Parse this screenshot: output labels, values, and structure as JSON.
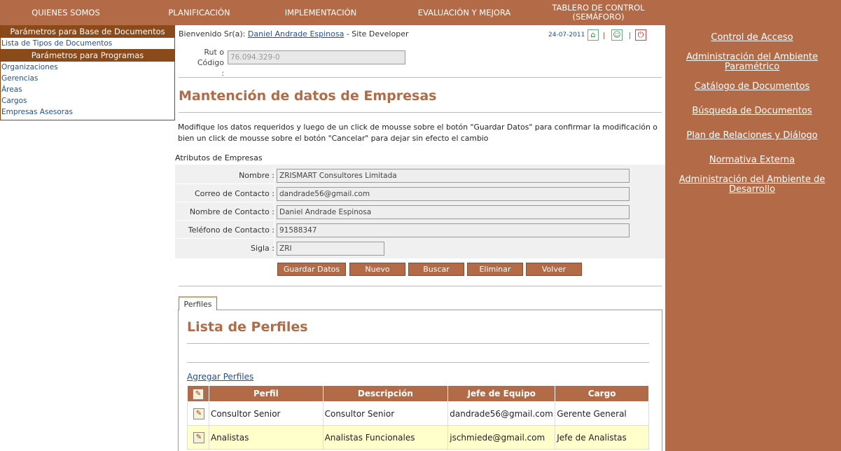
{
  "topnav": {
    "items": [
      "QUIENES SOMOS",
      "PLANIFICACIÓN",
      "IMPLEMENTACIÓN",
      "EVALUACIÓN Y MEJORA",
      "TABLERO DE CONTROL (SEMÁFORO)"
    ]
  },
  "sidebar": {
    "header1": "Parámetros para Base de Documentos",
    "item_tipos": "Lista de Tipos de Documentos",
    "header2": "Parámetros para Programas",
    "items": [
      "Organizaciones",
      "Gerencias",
      "Áreas",
      "Cargos",
      "Empresas Asesoras"
    ]
  },
  "header": {
    "welcome_prefix": "Bienvenido Sr(a):",
    "user": "Daniel Andrade Espinosa",
    "role": " - Site Developer",
    "date": "24-07-2011"
  },
  "rut": {
    "label": "Rut o Código :",
    "value": "76.094.329-0"
  },
  "page": {
    "title": "Mantención de datos de Empresas",
    "description": "Modifique los datos requeridos y luego de un click de mousse sobre el botón \"Guardar Datos\" para confirmar la modificación o bien un click de mousse sobre el botón \"Cancelar\" para dejar sin efecto el cambio",
    "attr_title": "Atributos de Empresas"
  },
  "fields": {
    "nombre_label": "Nombre :",
    "nombre_value": "ZRISMART Consultores Limitada",
    "correo_label": "Correo de Contacto :",
    "correo_value": "dandrade56@gmail.com",
    "contacto_label": "Nombre de Contacto :",
    "contacto_value": "Daniel Andrade Espinosa",
    "telefono_label": "Teléfono de Contacto :",
    "telefono_value": "91588347",
    "sigla_label": "Sigla :",
    "sigla_value": "ZRI"
  },
  "buttons": {
    "guardar": "Guardar Datos",
    "nuevo": "Nuevo",
    "buscar": "Buscar",
    "eliminar": "Eliminar",
    "volver": "Volver"
  },
  "tab": {
    "label": "Perfiles"
  },
  "perfiles": {
    "title": "Lista de Perfiles",
    "add_link": "Agregar Perfiles",
    "columns": [
      "Perfil",
      "Descripción",
      "Jefe de Equipo",
      "Cargo"
    ],
    "rows": [
      [
        "Consultor Senior",
        "Consultor Senior",
        "dandrade56@gmail.com",
        "Gerente General"
      ],
      [
        "Analistas",
        "Analistas Funcionales",
        "jschmiede@gmail.com",
        "Jefe de Analistas"
      ]
    ]
  },
  "rightpanel": {
    "links": [
      "Control de Acceso",
      "Administración del Ambiente Paramétrico",
      "Catálogo de Documentos",
      "Búsqueda de Documentos",
      "Plan de Relaciones y Diálogo",
      "Normativa Externa",
      "Administración del Ambiente de Desarrollo"
    ]
  },
  "colors": {
    "brand": "#b36b47",
    "dark_brand": "#8b4a1a",
    "link": "#2050a0",
    "highlight_row": "#ffffcc"
  }
}
